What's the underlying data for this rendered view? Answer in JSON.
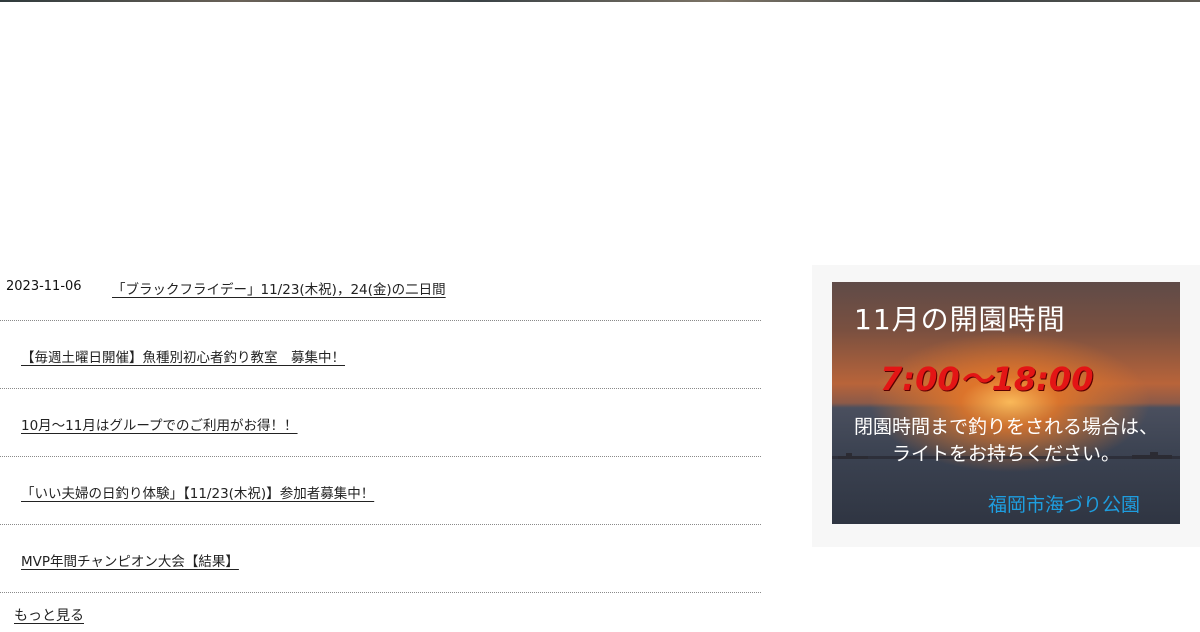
{
  "news": {
    "items": [
      {
        "date": "2023-11-06",
        "title": "「ブラックフライデー」11/23(木祝)，24(金)の二日間"
      },
      {
        "date": "",
        "title": "【毎週土曜日開催】魚種別初心者釣り教室　募集中！"
      },
      {
        "date": "",
        "title": "10月～11月はグループでのご利用がお得！！"
      },
      {
        "date": "",
        "title": "「いい夫婦の日釣り体験」【11/23(木祝)】参加者募集中！"
      },
      {
        "date": "",
        "title": "MVP年間チャンピオン大会【結果】"
      }
    ],
    "more_label": "もっと見る"
  },
  "banner": {
    "title": "11月の開園時間",
    "hours": "7:00～18:00",
    "notice_line1": "閉園時間まで釣りをされる場合は、",
    "notice_line2": "ライトをお持ちください。",
    "org_name": "福岡市海づり公園",
    "colors": {
      "hours": "#e31515",
      "org_name": "#1e9ee0"
    }
  }
}
